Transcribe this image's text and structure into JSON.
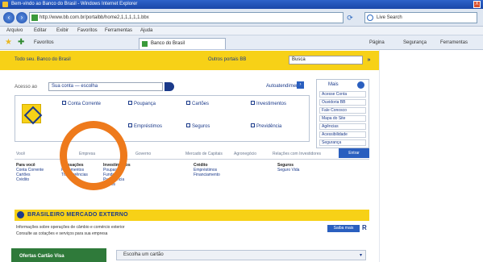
{
  "window": {
    "title": "Bem-vindo ao Banco do Brasil - Windows Internet Explorer",
    "close": "X"
  },
  "address": {
    "url": "http://www.bb.com.br/portalbb/home2,1,1,1,1,1.bbx",
    "search_placeholder": "Live Search"
  },
  "menu": [
    "Arquivo",
    "Editar",
    "Exibir",
    "Favoritos",
    "Ferramentas",
    "Ajuda"
  ],
  "favorites": {
    "label": "Favoritos",
    "tab": "Banco do Brasil",
    "tools": [
      "Página",
      "Segurança",
      "Ferramentas"
    ]
  },
  "bb_header": {
    "tagline": "Todo seu. Banco do Brasil",
    "portal_label": "Outros portais BB",
    "search_value": "Busca"
  },
  "login": {
    "label": "Acesso ao",
    "value": "Sua conta — escolha",
    "autoatend": "Autoatendimento"
  },
  "services": [
    {
      "label": "Conta Corrente"
    },
    {
      "label": "Poupança"
    },
    {
      "label": "Cartões"
    },
    {
      "label": "Investimentos"
    },
    {
      "label": "Empréstimos"
    },
    {
      "label": "Seguros"
    },
    {
      "label": "Previdência"
    }
  ],
  "side_panel": {
    "title": "Mais",
    "links": [
      "Acesse Conta",
      "Ouvidoria BB",
      "Fale Conosco",
      "Mapa do Site",
      "Agências",
      "Acessibilidade",
      "Segurança"
    ]
  },
  "tabs": [
    "Você",
    "Empresa",
    "Governo",
    "Mercado de Capitais",
    "Agronegócio",
    "Relações com Investidores"
  ],
  "tabs_button": "Entrar",
  "link_columns": [
    {
      "head": "Para você",
      "items": [
        "Conta Corrente",
        "Cartões",
        "Crédito"
      ]
    },
    {
      "head": "Transações",
      "items": [
        "Pagamentos",
        "Transferências"
      ]
    },
    {
      "head": "Investimentos",
      "items": [
        "Poupança",
        "Fundos",
        "Previdência",
        "Títulos"
      ]
    },
    {
      "head": "Crédito",
      "items": [
        "Empréstimos",
        "Financiamento"
      ]
    },
    {
      "head": "Seguros",
      "items": [
        "Seguro Vida"
      ]
    }
  ],
  "mercado": {
    "title": "BRASILEIRO MERCADO EXTERNO",
    "line1": "Informações sobre operações de câmbio e comércio exterior",
    "line2": "Consulte as cotações e serviços para sua empresa",
    "button": "Saiba mais",
    "r": "R"
  },
  "bottom": {
    "green_card": "Ofertas Cartão Visa",
    "select_label": "Escolha um cartão",
    "drop": "▾"
  },
  "colors": {
    "accent": "#f7d117",
    "brand_blue": "#1b3a8a",
    "annotation": "#ee7a1c"
  }
}
